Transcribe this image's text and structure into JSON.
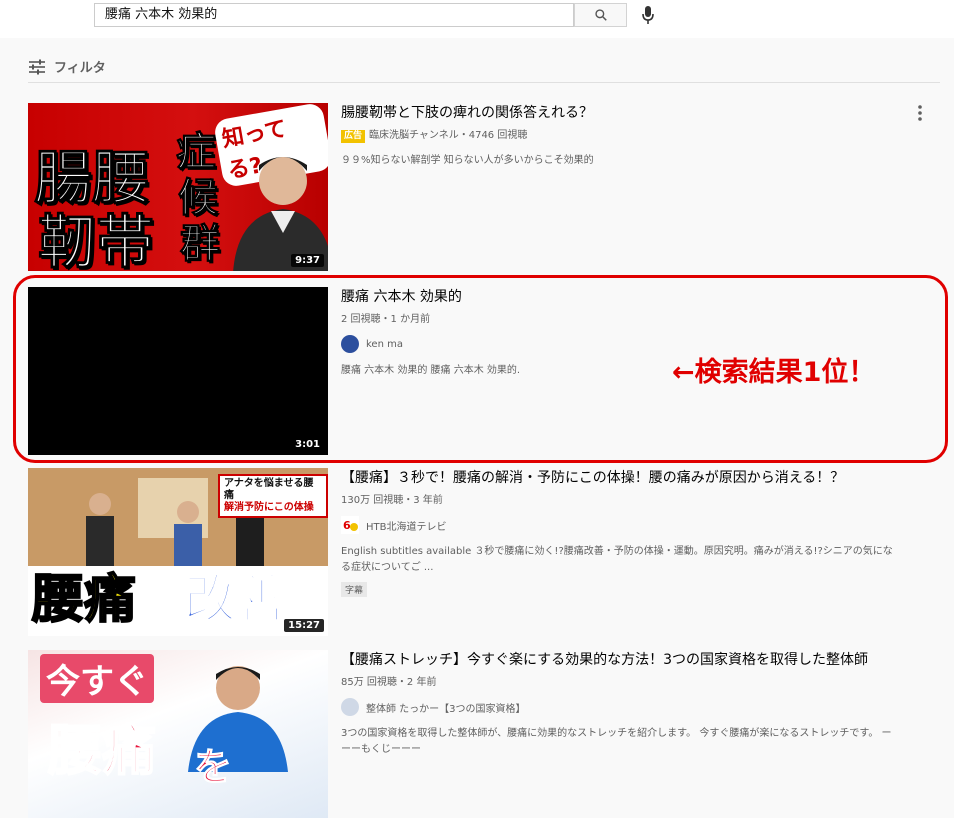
{
  "search": {
    "query": "腰痛 六本木 効果的"
  },
  "filter": {
    "label": "フィルタ"
  },
  "results": [
    {
      "title": "腸腰靭帯と下肢の痺れの関係答えれる？",
      "ad_label": "広告",
      "meta": "臨床洗脳チャンネル・4746 回視聴",
      "description": "９９%知らない解剖学 知らない人が多いからこそ効果的",
      "duration": "9:37",
      "thumb_text": {
        "line1": "腸腰",
        "line2": "靭帯",
        "side1": "症",
        "side2": "候",
        "side3": "群",
        "bubble": "知ってる?"
      }
    },
    {
      "title": "腰痛 六本木 効果的",
      "meta": "2 回視聴・1 か月前",
      "channel": "ken ma",
      "description": "腰痛 六本木 効果的 腰痛 六本木 効果的.",
      "duration": "3:01"
    },
    {
      "title": "【腰痛】３秒で！腰痛の解消・予防にこの体操！腰の痛みが原因から消える！？",
      "meta": "130万 回視聴・3 年前",
      "channel": "HTB北海道テレビ",
      "description": "English subtitles available ３秒で腰痛に効く!?腰痛改善・予防の体操・運動。原因究明。痛みが消える!?シニアの気になる症状についてご ...",
      "badge": "字幕",
      "duration": "15:27",
      "thumb_text": {
        "banner1": "アナタを悩ませる腰痛",
        "banner2": "解消予防にこの体操",
        "cap1": "腰痛",
        "cap2": "改善"
      }
    },
    {
      "title": "【腰痛ストレッチ】今すぐ楽にする効果的な方法！3つの国家資格を取得した整体師",
      "meta": "85万 回視聴・2 年前",
      "channel": "整体師 たっかー【3つの国家資格】",
      "description": "3つの国家資格を取得した整体師が、腰痛に効果的なストレッチを紹介します。 今すぐ腰痛が楽になるストレッチです。 ーーーもくじーーー",
      "thumb_text": {
        "c1": "今すぐ",
        "c2": "腰痛",
        "c3": "を"
      }
    }
  ],
  "annotation": {
    "text": "←検索結果1位！"
  },
  "colors": {
    "accent": "#e00000",
    "ad_badge": "#f2c200",
    "avatar_blue": "#2c4f9e"
  }
}
